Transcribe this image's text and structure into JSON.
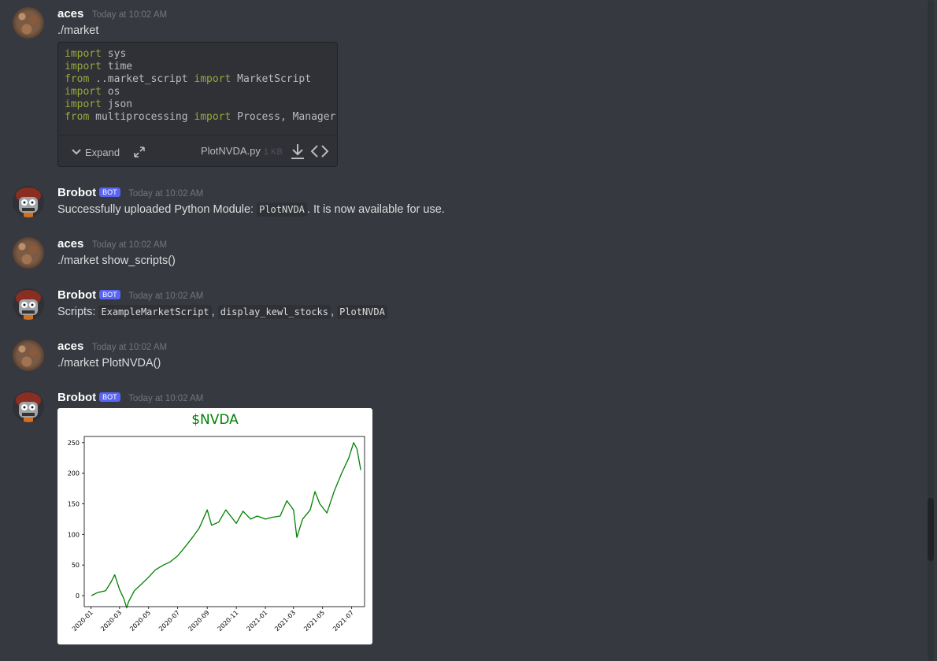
{
  "messages": [
    {
      "author": "aces",
      "time": "Today at 10:02 AM",
      "text": "./market"
    },
    {
      "author": "Brobot",
      "badge": "BOT",
      "time": "Today at 10:02 AM",
      "text_prefix": "Successfully uploaded Python Module: ",
      "code": "PlotNVDA",
      "text_suffix": ". It is now available for use."
    },
    {
      "author": "aces",
      "time": "Today at 10:02 AM",
      "text": "./market show_scripts()"
    },
    {
      "author": "Brobot",
      "badge": "BOT",
      "time": "Today at 10:02 AM",
      "text_prefix": "Scripts: ",
      "scripts": [
        "ExampleMarketScript",
        "display_kewl_stocks",
        "PlotNVDA"
      ],
      "sep": ","
    },
    {
      "author": "aces",
      "time": "Today at 10:02 AM",
      "text": "./market PlotNVDA()"
    },
    {
      "author": "Brobot",
      "badge": "BOT",
      "time": "Today at 10:02 AM"
    }
  ],
  "attachment": {
    "code_lines": [
      [
        "import",
        " sys"
      ],
      [
        "import",
        " time"
      ],
      [
        "from",
        " ..market_script ",
        "import",
        " MarketScript"
      ],
      [
        "import",
        " os"
      ],
      [
        "import",
        " json"
      ],
      [
        "from",
        " multiprocessing ",
        "import",
        " Process, Manager"
      ]
    ],
    "expand_label": "Expand",
    "filename": "PlotNVDA.py",
    "filesize": "1 KB"
  },
  "colors": {
    "keyword": "#99a83b",
    "chart_line": "#008000",
    "bot_badge": "#5865f2"
  },
  "chart_data": {
    "type": "line",
    "title": "$NVDA",
    "xlabel": "",
    "ylabel": "",
    "x_ticks": [
      "2020-01",
      "2020-03",
      "2020-05",
      "2020-07",
      "2020-09",
      "2020-11",
      "2021-01",
      "2021-03",
      "2021-05",
      "2021-07"
    ],
    "y_ticks": [
      0,
      50,
      100,
      150,
      200,
      250
    ],
    "ylim": [
      -18,
      260
    ],
    "xlim": [
      "2019-12-18",
      "2021-07-28"
    ],
    "series": [
      {
        "color": "#008000",
        "x": [
          "2020-01-02",
          "2020-01-15",
          "2020-02-01",
          "2020-02-12",
          "2020-02-20",
          "2020-03-01",
          "2020-03-10",
          "2020-03-16",
          "2020-03-20",
          "2020-04-01",
          "2020-04-15",
          "2020-05-01",
          "2020-05-15",
          "2020-06-01",
          "2020-06-15",
          "2020-07-01",
          "2020-07-15",
          "2020-08-01",
          "2020-08-15",
          "2020-09-01",
          "2020-09-10",
          "2020-09-25",
          "2020-10-10",
          "2020-10-25",
          "2020-11-01",
          "2020-11-15",
          "2020-12-01",
          "2020-12-15",
          "2021-01-01",
          "2021-01-15",
          "2021-02-01",
          "2021-02-15",
          "2021-03-01",
          "2021-03-08",
          "2021-03-20",
          "2021-04-05",
          "2021-04-15",
          "2021-04-25",
          "2021-05-10",
          "2021-05-25",
          "2021-06-10",
          "2021-06-25",
          "2021-07-05",
          "2021-07-12",
          "2021-07-20"
        ],
        "y": [
          0,
          5,
          8,
          22,
          34,
          10,
          -5,
          -20,
          -10,
          8,
          18,
          30,
          42,
          50,
          55,
          65,
          78,
          95,
          110,
          140,
          115,
          120,
          140,
          125,
          118,
          138,
          125,
          130,
          125,
          128,
          130,
          155,
          140,
          95,
          125,
          140,
          170,
          150,
          135,
          170,
          200,
          225,
          250,
          240,
          205
        ]
      }
    ]
  }
}
